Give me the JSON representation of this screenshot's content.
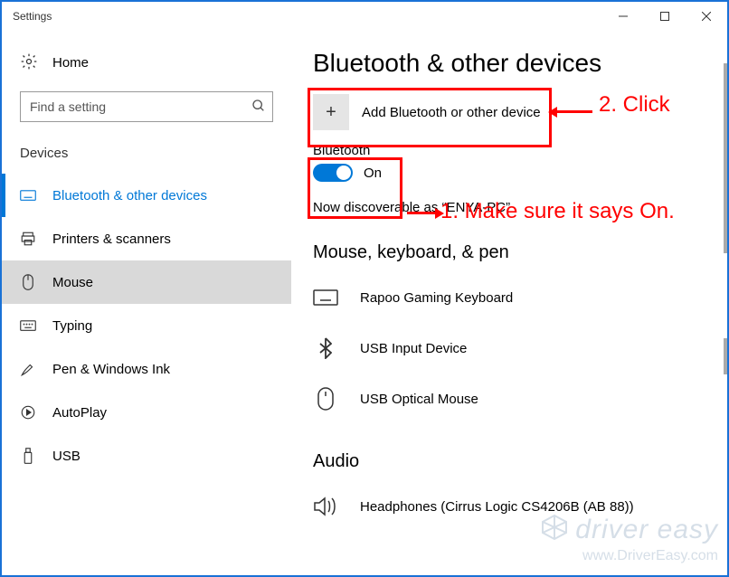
{
  "window": {
    "title": "Settings"
  },
  "home": {
    "label": "Home"
  },
  "search": {
    "placeholder": "Find a setting"
  },
  "group": {
    "header": "Devices"
  },
  "sidebar": {
    "items": [
      {
        "label": "Bluetooth & other devices"
      },
      {
        "label": "Printers & scanners"
      },
      {
        "label": "Mouse"
      },
      {
        "label": "Typing"
      },
      {
        "label": "Pen & Windows Ink"
      },
      {
        "label": "AutoPlay"
      },
      {
        "label": "USB"
      }
    ]
  },
  "page": {
    "title": "Bluetooth & other devices",
    "add_label": "Add Bluetooth or other device",
    "bt_label": "Bluetooth",
    "bt_state": "On",
    "discoverable": "Now discoverable as “ENYA-PC”"
  },
  "section1": {
    "header": "Mouse, keyboard, & pen",
    "items": [
      {
        "name": "Rapoo Gaming Keyboard",
        "icon": "keyboard"
      },
      {
        "name": "USB Input Device",
        "icon": "bluetooth"
      },
      {
        "name": "USB Optical Mouse",
        "icon": "mouse"
      }
    ]
  },
  "section2": {
    "header": "Audio",
    "items": [
      {
        "name": "Headphones (Cirrus Logic CS4206B (AB 88))",
        "icon": "speaker"
      }
    ]
  },
  "annotations": {
    "step1": "1. Make sure it says On.",
    "step2": "2. Click"
  },
  "watermark": {
    "line1": "driver easy",
    "line2": "www.DriverEasy.com"
  }
}
